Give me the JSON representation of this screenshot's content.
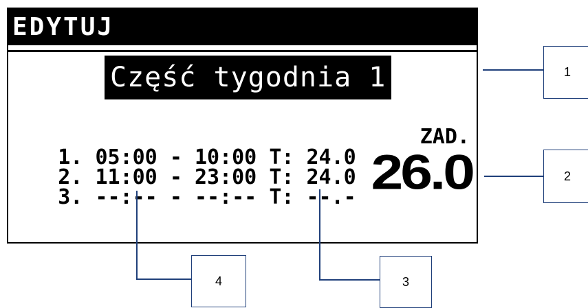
{
  "screen": {
    "header_title": "EDYTUJ",
    "subtitle": "Część tygodnia 1",
    "periods": [
      {
        "num": "1.",
        "start": "05:00",
        "dash": "-",
        "end": "10:00",
        "t_label": "T:",
        "temp": "24.0"
      },
      {
        "num": "2.",
        "start": "11:00",
        "dash": "-",
        "end": "23:00",
        "t_label": "T:",
        "temp": "24.0"
      },
      {
        "num": "3.",
        "start": "--:--",
        "dash": "-",
        "end": "--:--",
        "t_label": "T:",
        "temp": "--.-"
      }
    ],
    "setpoint_label": "ZAD.",
    "setpoint_value": "26.0"
  },
  "callouts": [
    "1",
    "2",
    "3",
    "4"
  ],
  "colors": {
    "leader": "#1f3f7a",
    "lcd_bg": "#ffffff",
    "lcd_fg": "#000000"
  }
}
